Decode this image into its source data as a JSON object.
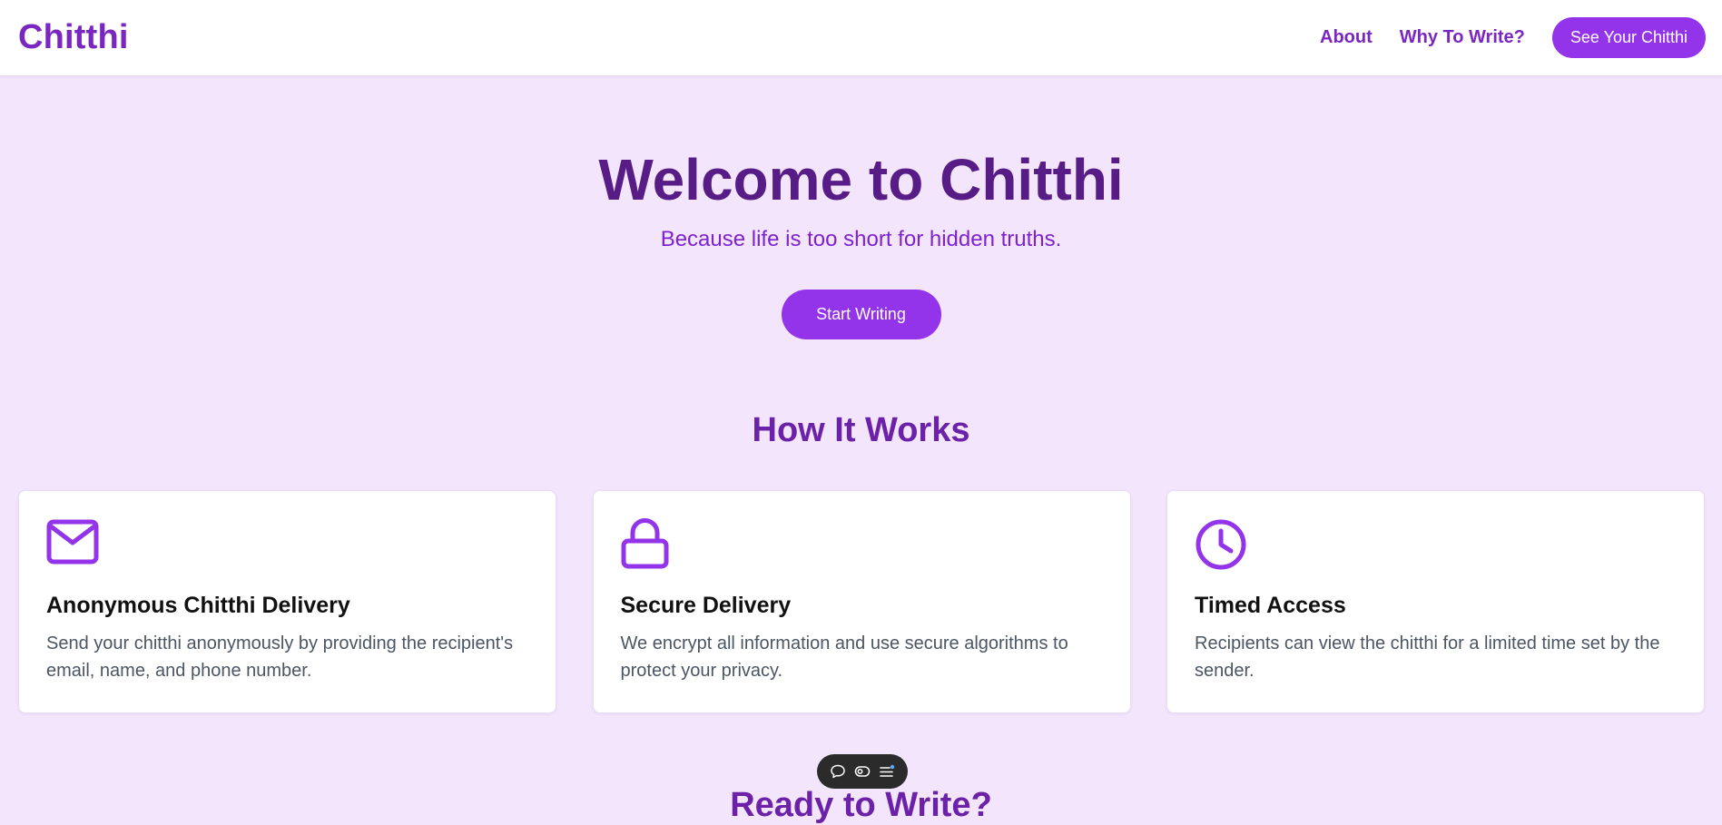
{
  "navbar": {
    "brand": "Chitthi",
    "links": [
      {
        "label": "About"
      },
      {
        "label": "Why To Write?"
      }
    ],
    "cta_label": "See Your Chitthi"
  },
  "hero": {
    "title": "Welcome to Chitthi",
    "subtitle": "Because life is too short for hidden truths.",
    "button_label": "Start Writing"
  },
  "how_it_works": {
    "title": "How It Works",
    "cards": [
      {
        "icon": "envelope-icon",
        "title": "Anonymous Chitthi Delivery",
        "text": "Send your chitthi anonymously by providing the recipient's email, name, and phone number."
      },
      {
        "icon": "lock-icon",
        "title": "Secure Delivery",
        "text": "We encrypt all information and use secure algorithms to protect your privacy."
      },
      {
        "icon": "clock-icon",
        "title": "Timed Access",
        "text": "Recipients can view the chitthi for a limited time set by the sender."
      }
    ]
  },
  "ready": {
    "title": "Ready to Write?"
  },
  "toolbar": {
    "icons": [
      "comment-icon",
      "toggle-icon",
      "menu-icon"
    ]
  },
  "colors": {
    "brand": "#7a26c1",
    "accent": "#9333ea",
    "hero_title": "#581c87",
    "background": "#f3e6fc"
  }
}
